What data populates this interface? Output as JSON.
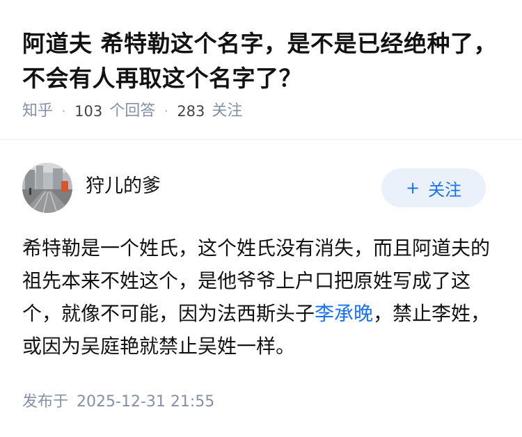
{
  "question": {
    "title": "阿道夫 希特勒这个名字，是不是已经绝种了，不会有人再取这个名字了？",
    "source": "知乎",
    "separator": "·",
    "answer_count": "103",
    "answer_label": "个回答",
    "follow_count": "283",
    "follow_label": "关注"
  },
  "author": {
    "name": "狩儿的爹",
    "follow_button": {
      "plus_icon": "+",
      "label": "关注"
    }
  },
  "answer": {
    "text_before_link": "希特勒是一个姓氏，这个姓氏没有消失，而且阿道夫的祖先本来不姓这个，是他爷爷上户口把原姓写成了这个，就像不可能，因为法西斯头子",
    "link_text": "李承晚",
    "text_after_link": "，禁止李姓，或因为吴庭艳就禁止吴姓一样。"
  },
  "publish": {
    "label": "发布于",
    "time": "2025-12-31 21:55"
  },
  "colors": {
    "link": "#1772f6",
    "meta": "#8590a6",
    "follow_bg": "#eaf1fb"
  }
}
